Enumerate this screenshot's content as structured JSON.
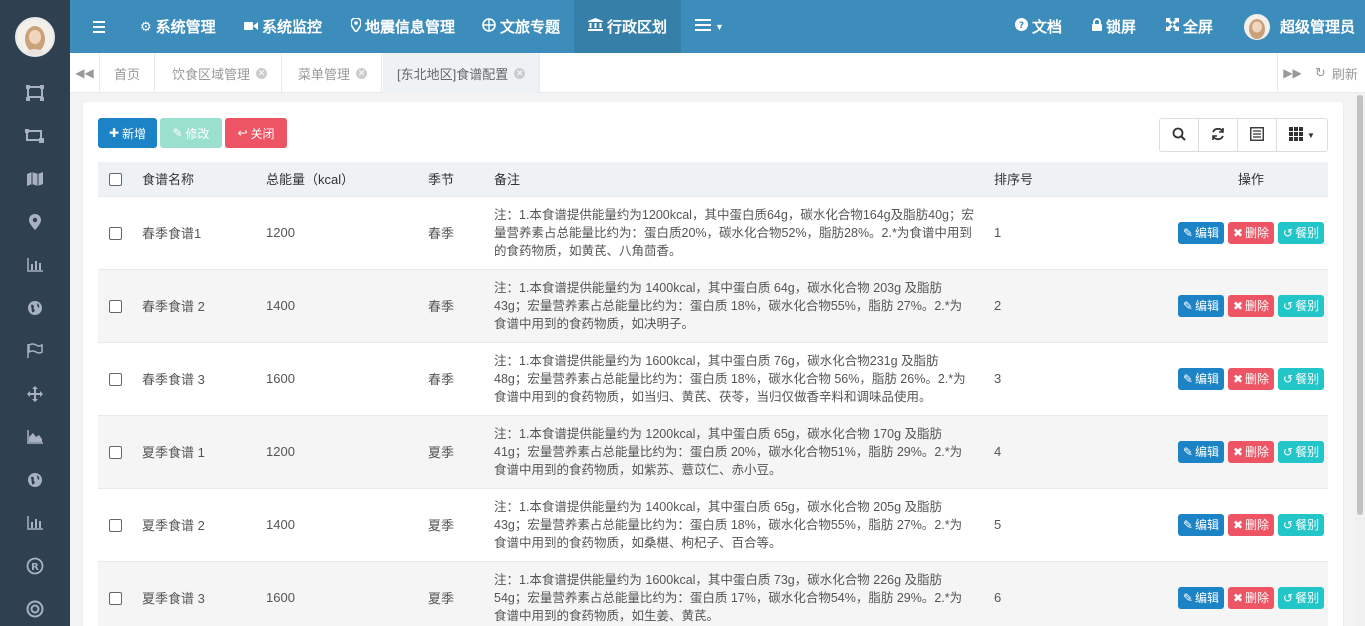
{
  "topnav": {
    "items": [
      {
        "icon": "gear-icon",
        "label": "系统管理"
      },
      {
        "icon": "video-icon",
        "label": "系统监控"
      },
      {
        "icon": "map-pin-icon",
        "label": "地震信息管理"
      },
      {
        "icon": "globe-icon",
        "label": "文旅专题"
      },
      {
        "icon": "bank-icon",
        "label": "行政区划"
      },
      {
        "icon": "list-icon",
        "label": ""
      }
    ],
    "active_index": 4,
    "right": {
      "docs_label": "文档",
      "lock_label": "锁屏",
      "fullscreen_label": "全屏",
      "user_label": "超级管理员"
    }
  },
  "tabs": {
    "items": [
      "首页",
      "饮食区域管理",
      "菜单管理",
      "[东北地区]食谱配置"
    ],
    "active_index": 3,
    "refresh_label": "刷新"
  },
  "toolbar": {
    "add_label": "新增",
    "edit_label": "修改",
    "close_label": "关闭"
  },
  "table": {
    "headers": [
      "食谱名称",
      "总能量（kcal）",
      "季节",
      "备注",
      "排序号",
      "操作"
    ],
    "action_labels": {
      "edit": "编辑",
      "delete": "删除",
      "meal": "餐别"
    },
    "rows": [
      {
        "name": "春季食谱1",
        "energy": "1200",
        "season": "春季",
        "remark": "注：1.本食谱提供能量约为1200kcal，其中蛋白质64g，碳水化合物164g及脂肪40g；宏量营养素占总能量比约为：蛋白质20%，碳水化合物52%，脂肪28%。2.*为食谱中用到的食药物质，如黄芪、八角茴香。",
        "order": "1"
      },
      {
        "name": "春季食谱 2",
        "energy": "1400",
        "season": "春季",
        "remark": "注：1.本食谱提供能量约为 1400kcal，其中蛋白质 64g，碳水化合物 203g 及脂肪 43g；宏量营养素占总能量比约为：蛋白质 18%，碳水化合物55%，脂肪 27%。2.*为食谱中用到的食药物质，如决明子。",
        "order": "2"
      },
      {
        "name": "春季食谱 3",
        "energy": "1600",
        "season": "春季",
        "remark": "注：1.本食谱提供能量约为 1600kcal，其中蛋白质 76g，碳水化合物231g 及脂肪 48g；宏量营养素占总能量比约为：蛋白质 18%，碳水化合物 56%，脂肪 26%。2.*为食谱中用到的食药物质，如当归、黄芪、茯苓，当归仅做香辛料和调味品使用。",
        "order": "3"
      },
      {
        "name": "夏季食谱 1",
        "energy": "1200",
        "season": "夏季",
        "remark": "注：1.本食谱提供能量约为 1200kcal，其中蛋白质 65g，碳水化合物 170g 及脂肪 41g；宏量营养素占总能量比约为：蛋白质 20%，碳水化合物51%，脂肪 29%。2.*为食谱中用到的食药物质，如紫苏、薏苡仁、赤小豆。",
        "order": "4"
      },
      {
        "name": "夏季食谱 2",
        "energy": "1400",
        "season": "夏季",
        "remark": "注：1.本食谱提供能量约为 1400kcal，其中蛋白质 65g，碳水化合物 205g 及脂肪 43g；宏量营养素占总能量比约为：蛋白质 18%，碳水化合物55%，脂肪 27%。2.*为食谱中用到的食药物质，如桑椹、枸杞子、百合等。",
        "order": "5"
      },
      {
        "name": "夏季食谱 3",
        "energy": "1600",
        "season": "夏季",
        "remark": "注：1.本食谱提供能量约为 1600kcal，其中蛋白质 73g，碳水化合物 226g 及脂肪 54g；宏量营养素占总能量比约为：蛋白质 17%，碳水化合物54%，脂肪 29%。2.*为食谱中用到的食药物质，如生姜、黄芪。",
        "order": "6"
      }
    ]
  },
  "colors": {
    "topbar": "#3c8dbc",
    "sidebar": "#2f4050",
    "primary": "#1c84c6",
    "danger": "#ed5565",
    "info": "#23c6c8"
  }
}
